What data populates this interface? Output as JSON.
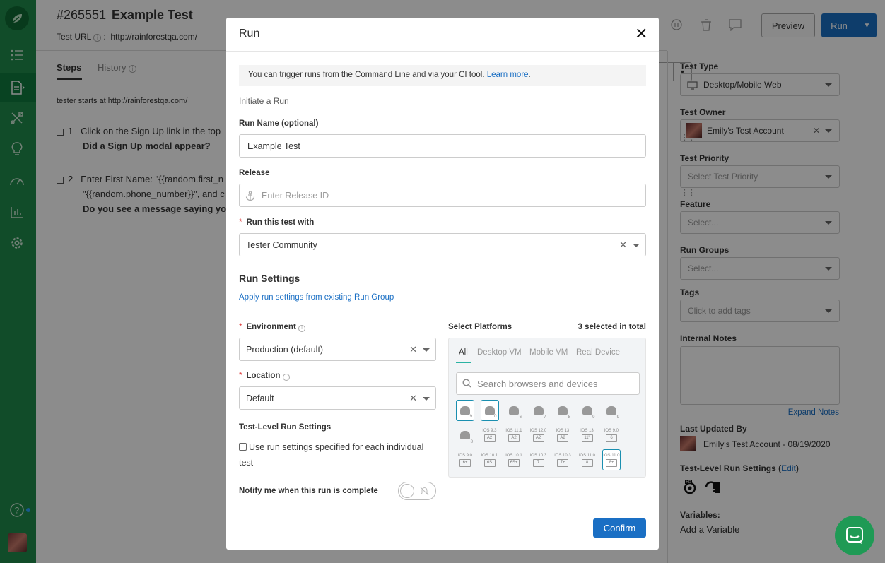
{
  "header": {
    "test_id": "#265551",
    "title": "Example Test",
    "url_label": "Test URL",
    "url_value": "http://rainforestqa.com/",
    "preview_label": "Preview",
    "run_label": "Run"
  },
  "tabs": {
    "steps": "Steps",
    "history": "History"
  },
  "steps": {
    "tester_start": "tester starts at http://rainforestqa.com/",
    "items": [
      {
        "num": "1",
        "action": "Click on the Sign Up link in the top",
        "question": "Did a Sign Up modal appear?"
      },
      {
        "num": "2",
        "action": "Enter First Name: \"{{random.first_n",
        "action2": "\"{{random.phone_number}}\", and c",
        "question": "Do you see a message saying your"
      }
    ]
  },
  "right_panel": {
    "test_type_label": "Test Type",
    "test_type_value": "Desktop/Mobile Web",
    "test_owner_label": "Test Owner",
    "test_owner_value": "Emily's Test Account",
    "test_priority_label": "Test Priority",
    "test_priority_placeholder": "Select Test Priority",
    "feature_label": "Feature",
    "feature_placeholder": "Select...",
    "run_groups_label": "Run Groups",
    "run_groups_placeholder": "Select...",
    "tags_label": "Tags",
    "tags_placeholder": "Click to add tags",
    "internal_notes_label": "Internal Notes",
    "expand_notes": "Expand Notes",
    "last_updated_label": "Last Updated By",
    "last_updated_value": "Emily's Test Account - 08/19/2020",
    "tlrs_label": "Test-Level Run Settings (",
    "tlrs_edit": "Edit",
    "tlrs_close": ")",
    "variables_label": "Variables:",
    "add_variable": "Add a Variable"
  },
  "modal": {
    "title": "Run",
    "close": "✕",
    "info_text": "You can trigger runs from the Command Line and via your CI tool.",
    "info_link": "Learn more",
    "info_period": ".",
    "initiate": "Initiate a Run",
    "run_name_label": "Run Name (optional)",
    "run_name_value": "Example Test",
    "release_label": "Release",
    "release_placeholder": "Enter Release ID",
    "run_with_label": "Run this test with",
    "run_with_value": "Tester Community",
    "run_settings_heading": "Run Settings",
    "apply_link": "Apply run settings from existing Run Group",
    "environment_label": "Environment",
    "environment_value": "Production (default)",
    "location_label": "Location",
    "location_value": "Default",
    "tlrs_heading": "Test-Level Run Settings",
    "tlrs_checkbox": "Use run settings specified for each individual",
    "tlrs_checkbox2": "test",
    "notify_label": "Notify me when this run is complete",
    "confirm": "Confirm",
    "platforms_label": "Select Platforms",
    "selected_count": "3 selected in total",
    "platform_tabs": [
      "All",
      "Desktop VM",
      "Mobile VM",
      "Real Device"
    ],
    "search_placeholder": "Search browsers and devices",
    "devices_row1": [
      {
        "kind": "android",
        "ver": "9",
        "selected": true
      },
      {
        "kind": "android",
        "ver": "10",
        "selected": true
      },
      {
        "kind": "android",
        "ver": "6",
        "selected": false
      },
      {
        "kind": "android",
        "ver": "7",
        "selected": false
      },
      {
        "kind": "android",
        "ver": "8",
        "selected": false
      },
      {
        "kind": "android",
        "ver": "9",
        "selected": false
      },
      {
        "kind": "android",
        "ver": "9",
        "selected": false
      }
    ],
    "devices_row2": [
      {
        "kind": "android",
        "ver": "8",
        "selected": false
      },
      {
        "kind": "ios",
        "ver": "iOS 9.3",
        "dev": "A2",
        "selected": false
      },
      {
        "kind": "ios",
        "ver": "iOS 11.1",
        "dev": "A2",
        "selected": false
      },
      {
        "kind": "ios",
        "ver": "iOS 12.0",
        "dev": "A2",
        "selected": false
      },
      {
        "kind": "ios",
        "ver": "iOS 13",
        "dev": "A2",
        "selected": false
      },
      {
        "kind": "ios",
        "ver": "iOS 13",
        "dev": "11\"",
        "selected": false
      },
      {
        "kind": "ios",
        "ver": "iOS 9.0",
        "dev": "6",
        "selected": false
      }
    ],
    "devices_row3": [
      {
        "kind": "ios",
        "ver": "iOS 9.0",
        "dev": "6+",
        "selected": false
      },
      {
        "kind": "ios",
        "ver": "iOS 10.1",
        "dev": "6S",
        "selected": false
      },
      {
        "kind": "ios",
        "ver": "iOS 10.1",
        "dev": "6S+",
        "selected": false
      },
      {
        "kind": "ios",
        "ver": "iOS 10.3",
        "dev": "7",
        "selected": false
      },
      {
        "kind": "ios",
        "ver": "iOS 10.3",
        "dev": "7+",
        "selected": false
      },
      {
        "kind": "ios",
        "ver": "iOS 11.0",
        "dev": "8",
        "selected": false
      },
      {
        "kind": "ios",
        "ver": "iOS 11.0",
        "dev": "8+",
        "selected": true
      }
    ]
  },
  "colors": {
    "sidebar": "#1f8a4b",
    "primary": "#1a6fc4",
    "accent": "#2bb3a3"
  }
}
